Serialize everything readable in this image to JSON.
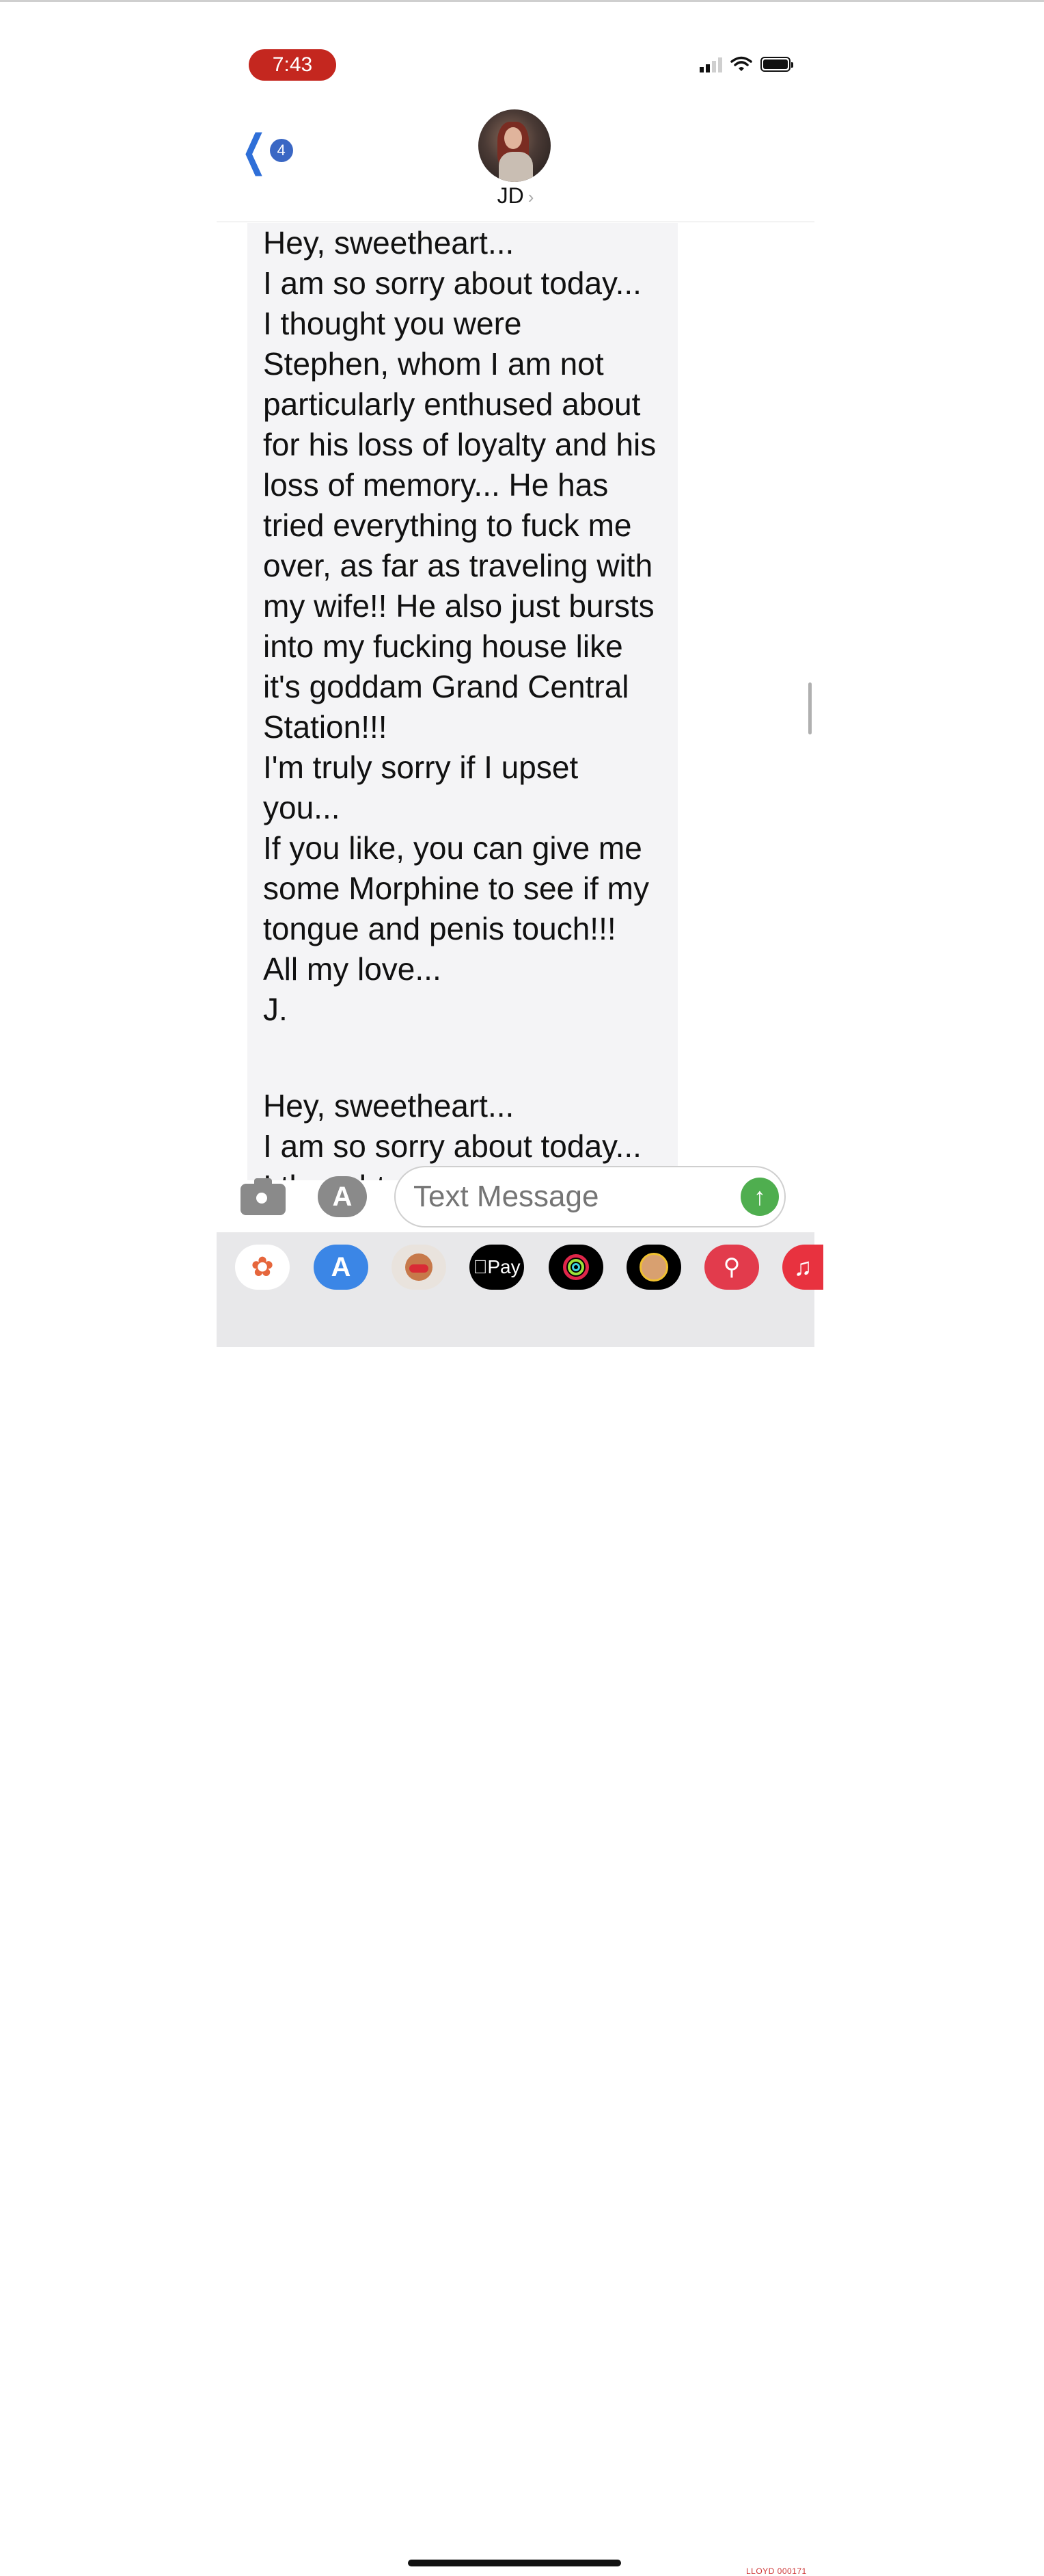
{
  "status_bar": {
    "time": "7:43"
  },
  "header": {
    "back_count": "4",
    "contact_name": "JD",
    "contact_arrow": "›"
  },
  "conversation": {
    "message_1": "Hey, sweetheart...\nI am so sorry about today...\nI thought you were\nStephen, whom I am not\nparticularly enthused about\nfor his loss of loyalty and his\nloss of memory... He has\ntried everything to fuck me\nover, as far as traveling with\nmy wife!! He also just bursts\ninto my fucking house like\nit's goddam Grand Central\nStation!!!\nI'm truly sorry if I upset\nyou...\nIf you like, you can give me\nsome Morphine to see if my\ntongue and penis touch!!!\nAll my love...\nJ.",
    "message_2": "Hey, sweetheart...\nI am so sorry about today...\nI thought you were"
  },
  "input_bar": {
    "placeholder": "Text Message",
    "send_icon": "arrow-up-icon"
  },
  "app_drawer": {
    "apps": [
      {
        "name": "Photos",
        "icon": "photos-icon"
      },
      {
        "name": "App Store",
        "icon": "app-store-icon",
        "glyph": "A"
      },
      {
        "name": "Memoji Stickers",
        "icon": "memoji-icon"
      },
      {
        "name": "Apple Pay",
        "icon": "apple-pay-icon",
        "label": "Pay"
      },
      {
        "name": "Activity",
        "icon": "activity-rings-icon"
      },
      {
        "name": "Animoji",
        "icon": "animoji-icon"
      },
      {
        "name": "Images",
        "icon": "image-search-icon"
      },
      {
        "name": "Music",
        "icon": "music-icon"
      }
    ]
  },
  "footer": {
    "bates_stamp": "LLOYD 000171"
  },
  "colors": {
    "time_pill": "#c4271f",
    "accent_blue": "#2f6fd8",
    "send_green": "#4fae4f"
  }
}
